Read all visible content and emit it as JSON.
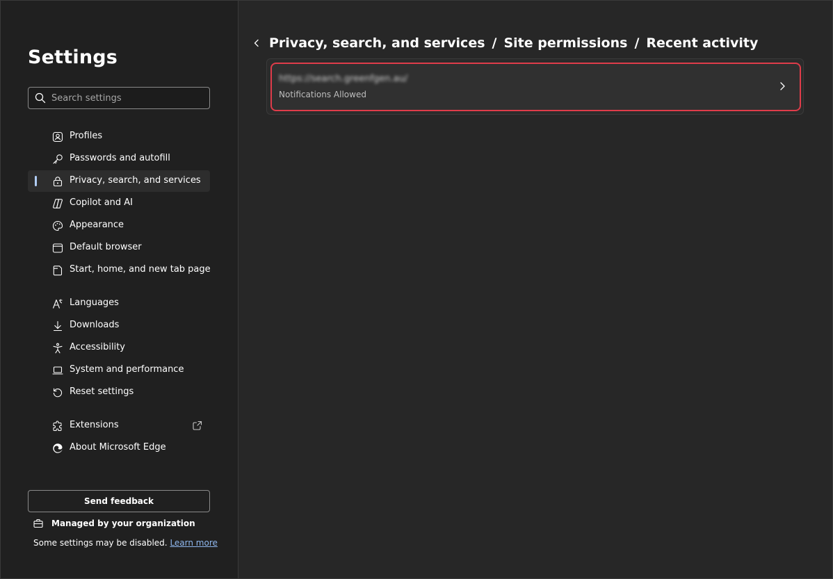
{
  "sidebar": {
    "title": "Settings",
    "search_placeholder": "Search settings",
    "items": [
      {
        "label": "Profiles"
      },
      {
        "label": "Passwords and autofill"
      },
      {
        "label": "Privacy, search, and services"
      },
      {
        "label": "Copilot and AI"
      },
      {
        "label": "Appearance"
      },
      {
        "label": "Default browser"
      },
      {
        "label": "Start, home, and new tab page"
      },
      {
        "label": "Languages"
      },
      {
        "label": "Downloads"
      },
      {
        "label": "Accessibility"
      },
      {
        "label": "System and performance"
      },
      {
        "label": "Reset settings"
      },
      {
        "label": "Extensions"
      },
      {
        "label": "About Microsoft Edge"
      }
    ],
    "active_item": "Privacy, search, and services",
    "feedback_label": "Send feedback",
    "managed_label": "Managed by your organization",
    "disabled_note": "Some settings may be disabled.",
    "learn_more": "Learn more"
  },
  "breadcrumb": {
    "items": [
      "Privacy, search, and services",
      "Site permissions",
      "Recent activity"
    ],
    "separator": "/"
  },
  "activity": {
    "site_url": "https://search.greenfgen.au/",
    "status": "Notifications Allowed"
  },
  "colors": {
    "accent": "#b1cdf7",
    "highlight_border": "#e03c4a",
    "link": "#8fb8ef"
  }
}
